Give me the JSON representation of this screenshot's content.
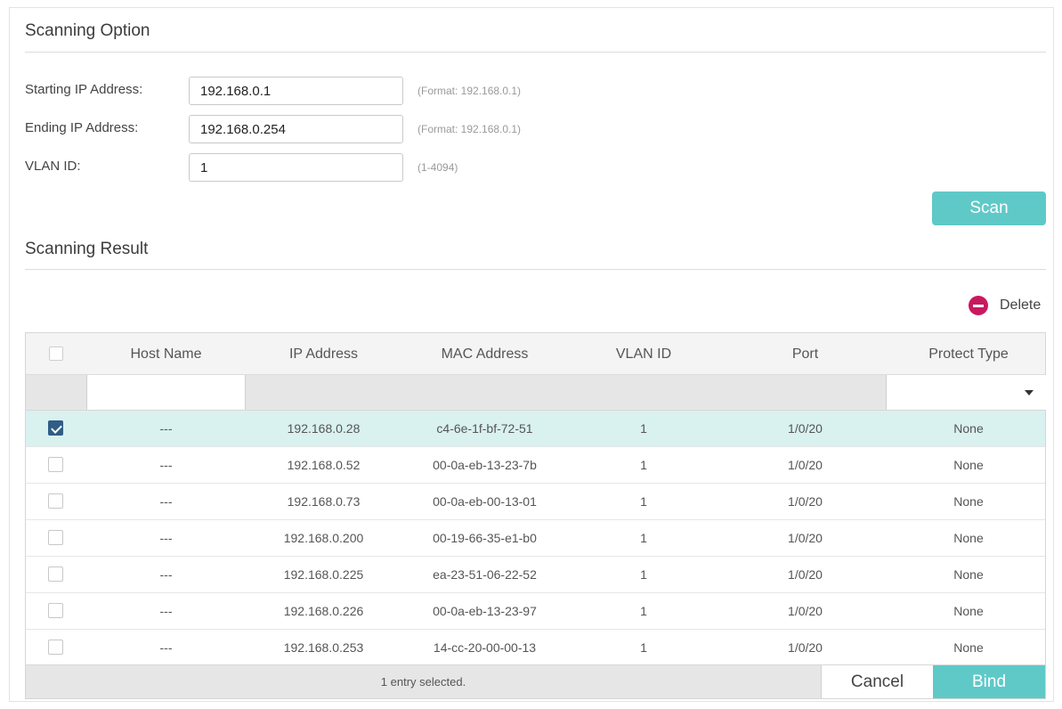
{
  "scanning_option": {
    "title": "Scanning Option",
    "fields": [
      {
        "label": "Starting IP Address:",
        "value": "192.168.0.1",
        "hint": "(Format: 192.168.0.1)"
      },
      {
        "label": "Ending IP Address:",
        "value": "192.168.0.254",
        "hint": "(Format: 192.168.0.1)"
      },
      {
        "label": "VLAN ID:",
        "value": "1",
        "hint": "(1-4094)"
      }
    ],
    "scan_label": "Scan"
  },
  "scanning_result": {
    "title": "Scanning Result",
    "delete_label": "Delete",
    "columns": [
      "Host Name",
      "IP Address",
      "MAC Address",
      "VLAN ID",
      "Port",
      "Protect Type"
    ],
    "filter": {
      "host_name_value": "",
      "protect_type_value": ""
    },
    "rows": [
      {
        "selected": true,
        "host": "---",
        "ip": "192.168.0.28",
        "mac": "c4-6e-1f-bf-72-51",
        "vlan": "1",
        "port": "1/0/20",
        "protect": "None"
      },
      {
        "selected": false,
        "host": "---",
        "ip": "192.168.0.52",
        "mac": "00-0a-eb-13-23-7b",
        "vlan": "1",
        "port": "1/0/20",
        "protect": "None"
      },
      {
        "selected": false,
        "host": "---",
        "ip": "192.168.0.73",
        "mac": "00-0a-eb-00-13-01",
        "vlan": "1",
        "port": "1/0/20",
        "protect": "None"
      },
      {
        "selected": false,
        "host": "---",
        "ip": "192.168.0.200",
        "mac": "00-19-66-35-e1-b0",
        "vlan": "1",
        "port": "1/0/20",
        "protect": "None"
      },
      {
        "selected": false,
        "host": "---",
        "ip": "192.168.0.225",
        "mac": "ea-23-51-06-22-52",
        "vlan": "1",
        "port": "1/0/20",
        "protect": "None"
      },
      {
        "selected": false,
        "host": "---",
        "ip": "192.168.0.226",
        "mac": "00-0a-eb-13-23-97",
        "vlan": "1",
        "port": "1/0/20",
        "protect": "None"
      },
      {
        "selected": false,
        "host": "---",
        "ip": "192.168.0.253",
        "mac": "14-cc-20-00-00-13",
        "vlan": "1",
        "port": "1/0/20",
        "protect": "None"
      }
    ],
    "footer_status": "1 entry selected.",
    "cancel_label": "Cancel",
    "bind_label": "Bind"
  },
  "colors": {
    "accent": "#5fc9c8",
    "delete": "#c8195f",
    "checked": "#2f5d86",
    "selected_row": "#d9f1ef"
  }
}
